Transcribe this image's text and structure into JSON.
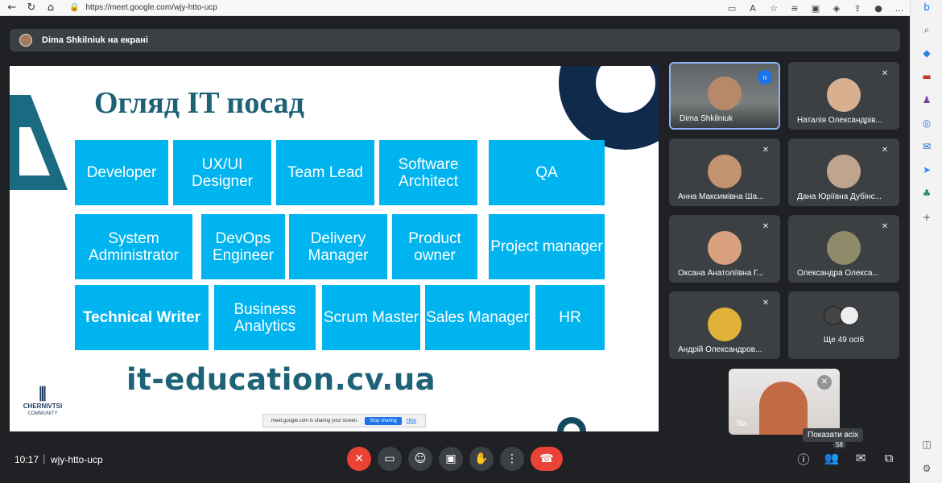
{
  "browser": {
    "url": "https://meet.google.com/wjy-htto-ucp"
  },
  "presenter": {
    "label": "Dima Shkilniuk на екрані"
  },
  "slide": {
    "title": "Огляд IT посад",
    "boxes": [
      "Developer",
      "UX/UI Designer",
      "Team  Lead",
      "Software Architect",
      "QA",
      "System Administrator",
      "DevOps Engineer",
      "Delivery Manager",
      "Product owner",
      "Project manager",
      "Technical Writer",
      "Business Analytics",
      "Scrum Master",
      "Sales Manager",
      "HR"
    ],
    "website": "it-education.cv.ua",
    "logo_line1": "CHERNIVTSI",
    "logo_line2": "COMMUNITY"
  },
  "share_notice": {
    "text": "meet.google.com is sharing your screen.",
    "stop": "Stop sharing",
    "hide": "Hide"
  },
  "participants": [
    {
      "name": "Dima Shkilniuk"
    },
    {
      "name": "Наталія Олександрів..."
    },
    {
      "name": "Анна Максимівна Ша..."
    },
    {
      "name": "Дана Юріївна Дубінс..."
    },
    {
      "name": "Оксана Анатоліївна Г..."
    },
    {
      "name": "Олександра Олекса..."
    },
    {
      "name": "Андрій Олександров..."
    }
  ],
  "more": {
    "label": "Ще 49 осіб"
  },
  "self": {
    "label": "Ви"
  },
  "bottom": {
    "time": "10:17",
    "separator": "|",
    "meeting_code": "wjy-htto-ucp",
    "tooltip": "Показати всіх",
    "people_count": "58"
  }
}
